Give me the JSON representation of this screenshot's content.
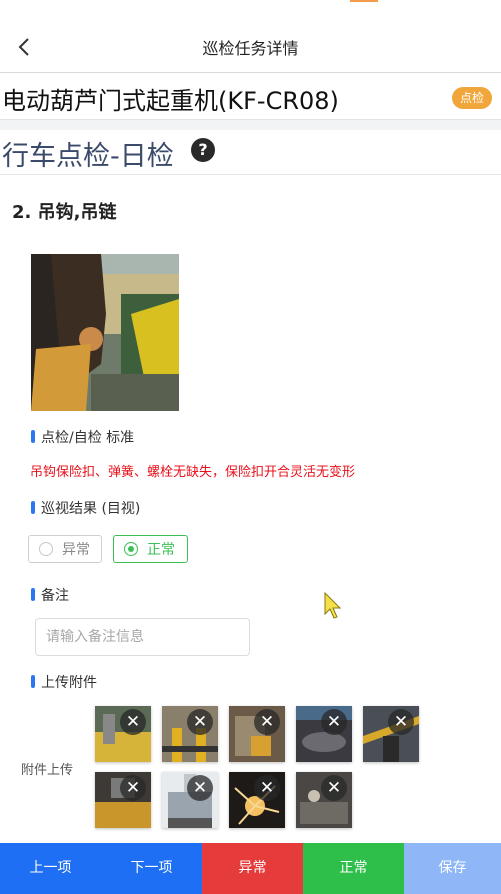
{
  "header": {
    "title": "巡检任务详情"
  },
  "device": {
    "name": "电动葫芦门式起重机(KF-CR08)",
    "badge": "点检"
  },
  "section": {
    "name": "行车点检-日检",
    "help_glyph": "?"
  },
  "item": {
    "title": "2. 吊钩,吊链",
    "standard_label": "点检/自检 标准",
    "standard_text": "吊钩保险扣、弹簧、螺栓无缺失，保险扣开合灵活无变形",
    "result_label": "巡视结果 (目视)",
    "result_options": [
      "异常",
      "正常"
    ],
    "result_selected": "正常",
    "remark_label": "备注",
    "remark_placeholder": "请输入备注信息",
    "remark_value": "",
    "attachments_label": "上传附件",
    "attachments_upload_label": "附件上传",
    "attachments_count": 9,
    "delete_glyph": "✕"
  },
  "footer": {
    "buttons": [
      {
        "label": "上一项",
        "color": "#1e6ff3"
      },
      {
        "label": "下一项",
        "color": "#1e6ff3"
      },
      {
        "label": "异常",
        "color": "#e63b3b"
      },
      {
        "label": "正常",
        "color": "#2ebe4a"
      },
      {
        "label": "保存",
        "color": "#8fb6f7"
      }
    ]
  }
}
